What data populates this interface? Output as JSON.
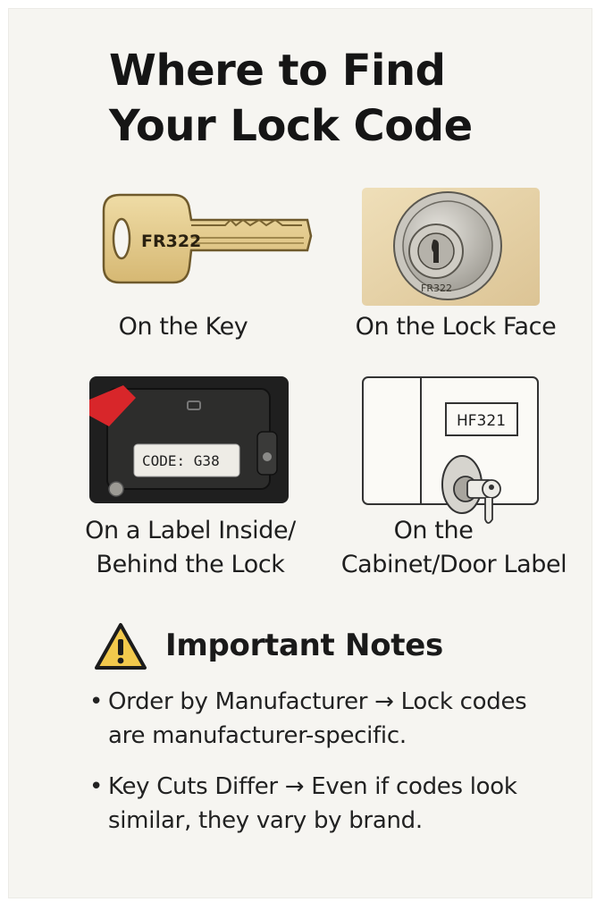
{
  "title": {
    "line1": "Where to Find",
    "line2": "Your Lock Code"
  },
  "locations": [
    {
      "caption": "On the Key",
      "code": "FR322"
    },
    {
      "caption": "On the Lock Face",
      "code": "FR322"
    },
    {
      "caption_line1": "On a Label Inside/",
      "caption_line2": "Behind the Lock",
      "code": "CODE: G38"
    },
    {
      "caption_line1": "On the",
      "caption_line2": "Cabinet/Door Label",
      "code": "HF321"
    }
  ],
  "notes": {
    "heading": "Important Notes",
    "icon": "warning-icon",
    "bullet": "•",
    "items": [
      {
        "line1": "Order by Manufacturer → Lock codes",
        "line2": "are manufacturer-specific."
      },
      {
        "line1": "Key Cuts Differ → Even if codes look",
        "line2": "similar, they vary by brand."
      }
    ]
  },
  "colors": {
    "background": "#f6f5f1",
    "key_brass": "#e2c98a",
    "wood": "#e7d3a8",
    "label_red": "#d8262a",
    "warning_yellow": "#f2c94c"
  }
}
